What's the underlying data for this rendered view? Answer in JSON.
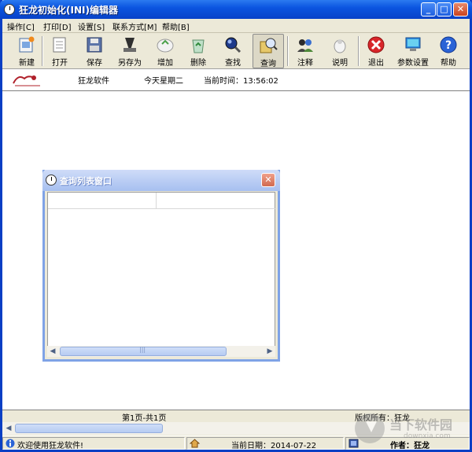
{
  "window": {
    "title": "狂龙初始化(INI)编辑器"
  },
  "menu": {
    "items": [
      "操作[C]",
      "打印[D]",
      "设置[S]",
      "联系方式[M]",
      "帮助[B]"
    ]
  },
  "toolbar": {
    "new": "新建",
    "open": "打开",
    "save": "保存",
    "save_as": "另存为",
    "add": "增加",
    "delete": "删除",
    "find": "查找",
    "query": "查询",
    "comment": "注释",
    "about": "说明",
    "exit": "退出",
    "settings": "参数设置",
    "help": "帮助"
  },
  "info": {
    "company": "狂龙软件",
    "day": "今天星期二",
    "time": "当前时间：13:56:02"
  },
  "dialog": {
    "title": "查询列表窗口"
  },
  "pager": {
    "page": "第1页-共1页",
    "copyright": "版权所有：狂龙"
  },
  "status": {
    "welcome": "欢迎使用狂龙软件!",
    "date": "当前日期：2014-07-22",
    "author": "作者：狂龙"
  },
  "watermark": {
    "name": "当下软件园",
    "url": "downxia.com"
  },
  "colors": {
    "titlebar": "#0b55e0",
    "dialog_title": "#a6bff0",
    "close_red": "#d8262a"
  }
}
